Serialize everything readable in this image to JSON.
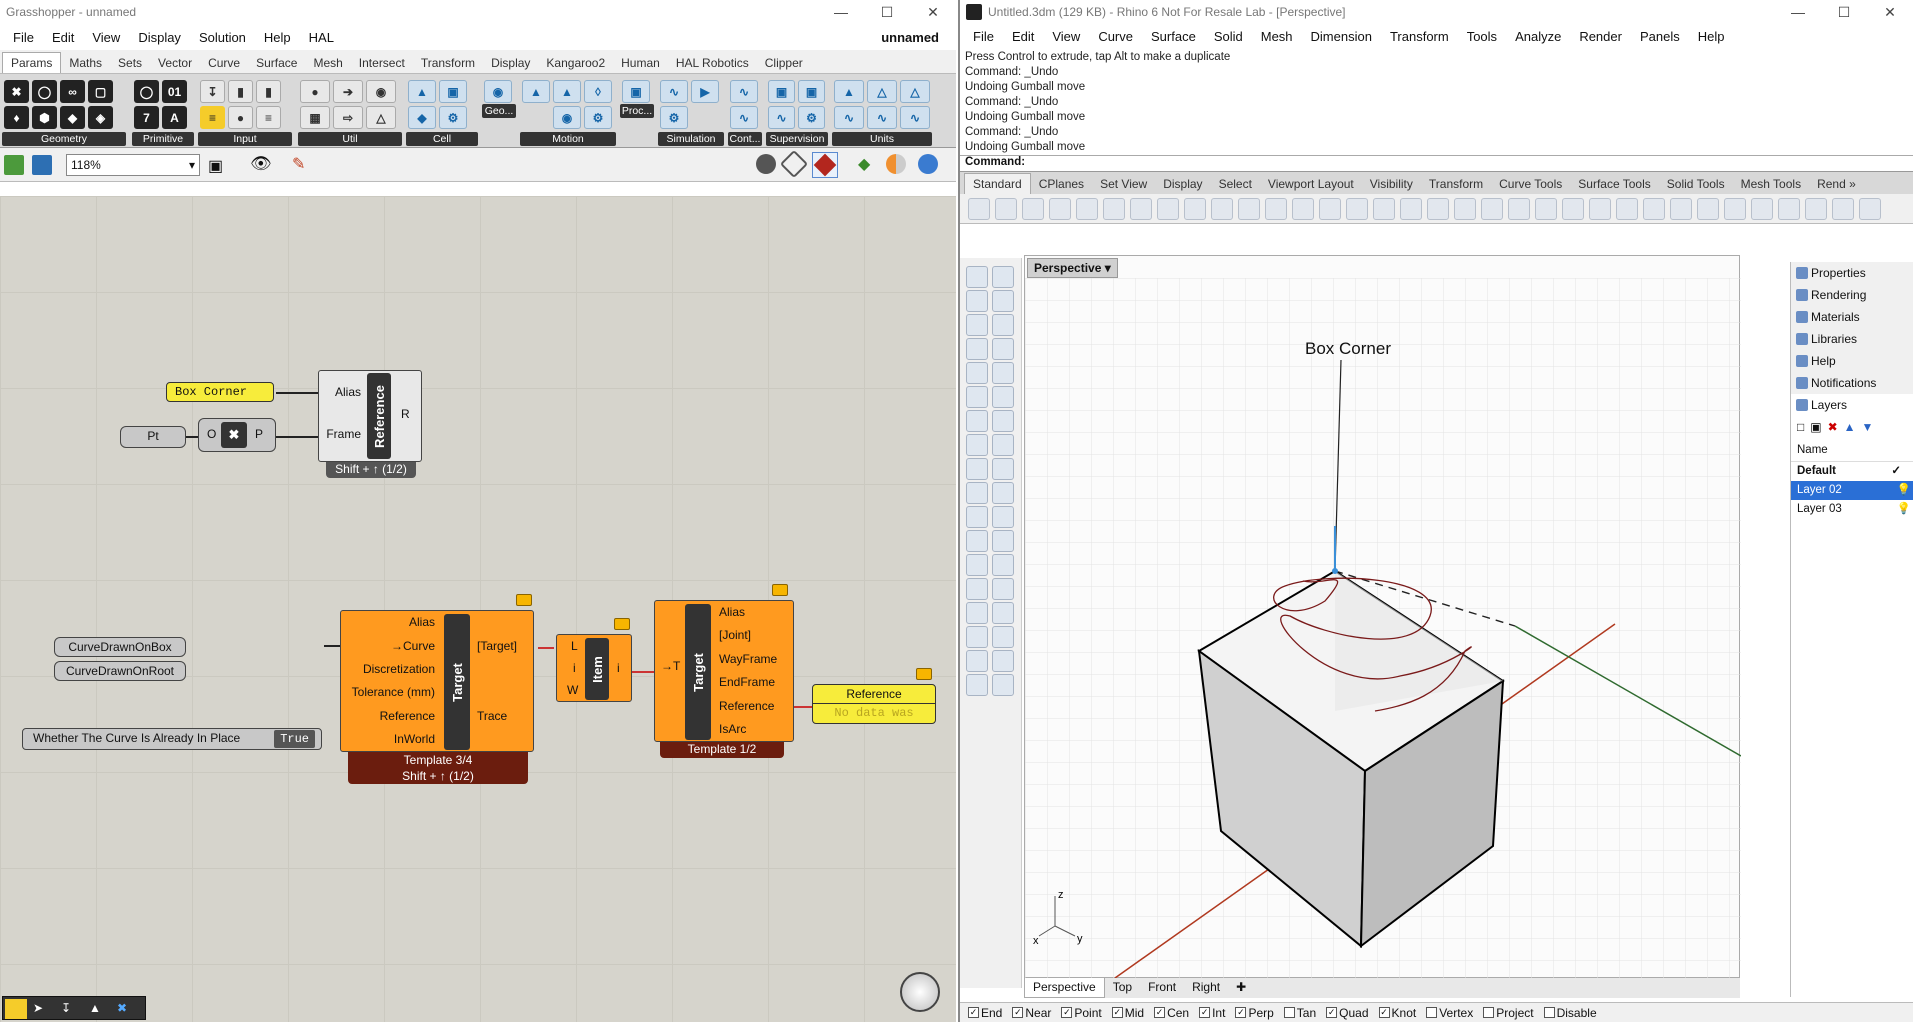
{
  "gh": {
    "title": "Grasshopper - unnamed",
    "doc_name": "unnamed",
    "menu": [
      "File",
      "Edit",
      "View",
      "Display",
      "Solution",
      "Help",
      "HAL"
    ],
    "tabs": [
      "Params",
      "Maths",
      "Sets",
      "Vector",
      "Curve",
      "Surface",
      "Mesh",
      "Intersect",
      "Transform",
      "Display",
      "Kangaroo2",
      "Human",
      "HAL Robotics",
      "Clipper"
    ],
    "groups": [
      "Geometry",
      "Primitive",
      "Input",
      "Util",
      "Cell",
      "Geo...",
      "Motion",
      "Proc...",
      "Simulation",
      "Cont...",
      "Supervision",
      "Units"
    ],
    "zoom": "118%",
    "canvas": {
      "box_corner_panel": "Box Corner",
      "pt_param": "Pt",
      "xy_o": "O",
      "xy_p": "P",
      "ref1": {
        "inputs": [
          "Alias",
          "Frame"
        ],
        "name": "Reference",
        "output": "R",
        "footer": "Shift + ↑ (1/2)"
      },
      "curve_box": "CurveDrawnOnBox",
      "curve_root": "CurveDrawnOnRoot",
      "toggle_label": "Whether The Curve Is Already In Place",
      "toggle_value": "True",
      "target1": {
        "inputs": [
          "Alias",
          "→Curve",
          "Discretization",
          "Tolerance (mm)",
          "Reference",
          "InWorld"
        ],
        "name": "Target",
        "outputs": [
          "[Target]",
          "Trace"
        ],
        "footer1": "Template 3/4",
        "footer2": "Shift + ↑ (1/2)"
      },
      "item": {
        "inputs": [
          "L",
          "i",
          "W"
        ],
        "name": "Item",
        "output": "i"
      },
      "target2": {
        "input": "→T",
        "name": "Target",
        "outputs": [
          "Alias",
          "[Joint]",
          "WayFrame",
          "EndFrame",
          "Reference",
          "IsArc"
        ],
        "footer": "Template 1/2"
      },
      "ref_panel": {
        "title": "Reference",
        "text": "No data was"
      }
    }
  },
  "rh": {
    "title": "Untitled.3dm (129 KB) - Rhino 6 Not For Resale Lab - [Perspective]",
    "menu": [
      "File",
      "Edit",
      "View",
      "Curve",
      "Surface",
      "Solid",
      "Mesh",
      "Dimension",
      "Transform",
      "Tools",
      "Analyze",
      "Render",
      "Panels",
      "Help"
    ],
    "history": [
      "Press Control to extrude, tap Alt to make a duplicate",
      "Command: _Undo",
      "Undoing Gumball move",
      "Command: _Undo",
      "Undoing Gumball move",
      "Command: _Undo",
      "Undoing Gumball move"
    ],
    "command_prompt": "Command:",
    "toolbar_tabs": [
      "Standard",
      "CPlanes",
      "Set View",
      "Display",
      "Select",
      "Viewport Layout",
      "Visibility",
      "Transform",
      "Curve Tools",
      "Surface Tools",
      "Solid Tools",
      "Mesh Tools",
      "Rend »"
    ],
    "viewport_title": "Perspective",
    "viewport_label": "Box Corner",
    "axis": {
      "x": "x",
      "y": "y",
      "z": "z"
    },
    "view_tabs": [
      "Perspective",
      "Top",
      "Front",
      "Right"
    ],
    "panels": [
      "Properties",
      "Rendering",
      "Materials",
      "Libraries",
      "Help",
      "Notifications",
      "Layers"
    ],
    "layers_header": "Name",
    "layers": [
      "Default",
      "Layer 02",
      "Layer 03"
    ],
    "osnaps": [
      {
        "label": "End",
        "checked": true
      },
      {
        "label": "Near",
        "checked": true
      },
      {
        "label": "Point",
        "checked": true
      },
      {
        "label": "Mid",
        "checked": true
      },
      {
        "label": "Cen",
        "checked": true
      },
      {
        "label": "Int",
        "checked": true
      },
      {
        "label": "Perp",
        "checked": true
      },
      {
        "label": "Tan",
        "checked": false
      },
      {
        "label": "Quad",
        "checked": true
      },
      {
        "label": "Knot",
        "checked": true
      },
      {
        "label": "Vertex",
        "checked": false
      },
      {
        "label": "Project",
        "checked": false
      },
      {
        "label": "Disable",
        "checked": false
      }
    ]
  }
}
